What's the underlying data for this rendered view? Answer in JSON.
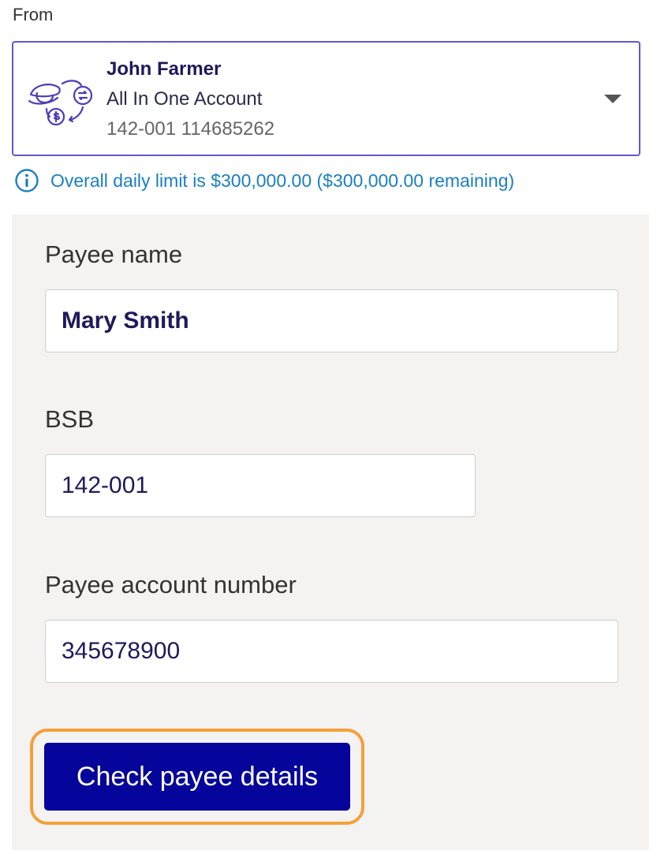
{
  "from_label": "From",
  "account": {
    "name": "John Farmer",
    "type": "All In One Account",
    "number": "142-001 114685262",
    "icon": "account-transfer-icon"
  },
  "limit_info": {
    "icon": "info-icon",
    "text": "Overall daily limit is $300,000.00 ($300,000.00 remaining)"
  },
  "form": {
    "payee_name_label": "Payee name",
    "payee_name_value": "Mary Smith",
    "bsb_label": "BSB",
    "bsb_value": "142-001",
    "account_number_label": "Payee account number",
    "account_number_value": "345678900",
    "check_button_label": "Check payee details"
  },
  "colors": {
    "brand_button": "#05059b",
    "selector_border": "#5f59c9",
    "info_blue": "#1a7fc1",
    "focus_ring": "#f5a03a",
    "panel_background": "#f4f3f2"
  }
}
